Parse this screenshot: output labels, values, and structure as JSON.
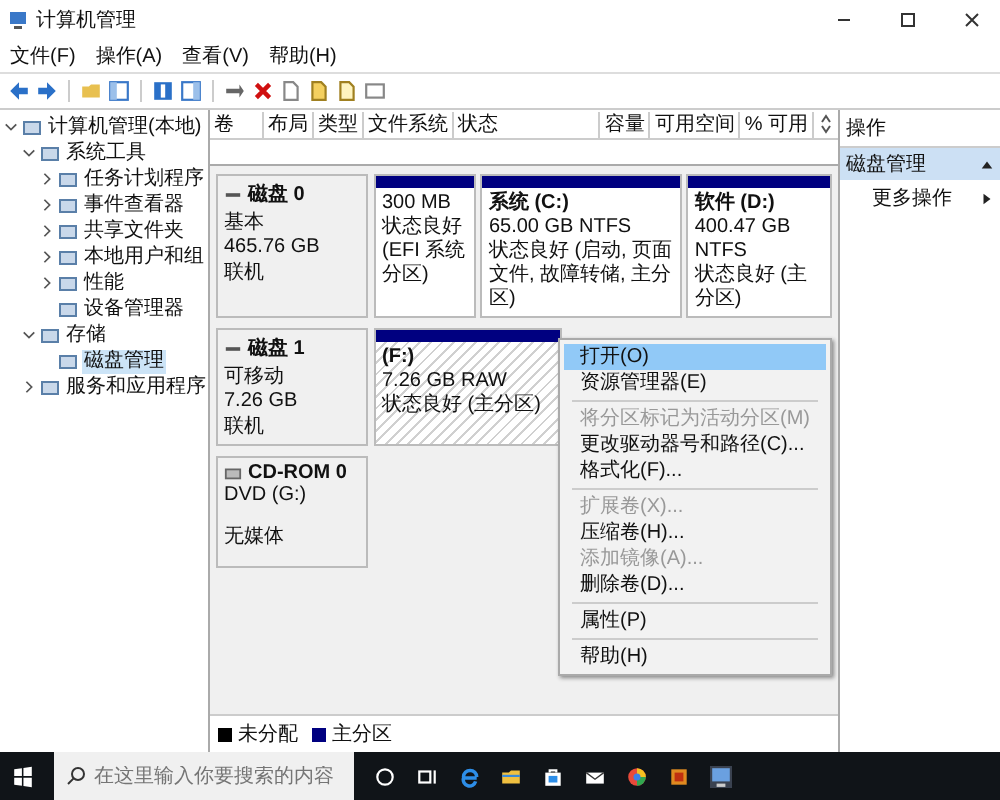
{
  "window": {
    "title": "计算机管理"
  },
  "menu_bar": [
    "文件(F)",
    "操作(A)",
    "查看(V)",
    "帮助(H)"
  ],
  "tree": [
    {
      "label": "计算机管理(本地)",
      "expanded": true,
      "selected": false,
      "children": [
        {
          "label": "系统工具",
          "expanded": true,
          "selected": false,
          "children": [
            {
              "label": "任务计划程序",
              "expanded": false,
              "selected": false
            },
            {
              "label": "事件查看器",
              "expanded": false,
              "selected": false
            },
            {
              "label": "共享文件夹",
              "expanded": false,
              "selected": false
            },
            {
              "label": "本地用户和组",
              "expanded": false,
              "selected": false
            },
            {
              "label": "性能",
              "expanded": false,
              "selected": false
            },
            {
              "label": "设备管理器",
              "selected": false
            }
          ]
        },
        {
          "label": "存储",
          "expanded": true,
          "selected": false,
          "children": [
            {
              "label": "磁盘管理",
              "selected": true
            }
          ]
        },
        {
          "label": "服务和应用程序",
          "expanded": false,
          "selected": false
        }
      ]
    }
  ],
  "table": {
    "columns": [
      "卷",
      "布局",
      "类型",
      "文件系统",
      "状态",
      "容量",
      "可用空间",
      "% 可用"
    ]
  },
  "disks": [
    {
      "kind": "disk",
      "name": "磁盘 0",
      "lines": [
        "基本",
        "465.76 GB",
        "联机"
      ],
      "partitions": [
        {
          "size": "300 MB",
          "status": "状态良好 (EFI 系统分区)",
          "selected": false
        },
        {
          "title": "系统 (C:)",
          "size": "65.00 GB NTFS",
          "status": "状态良好 (启动, 页面文件, 故障转储, 主分区)",
          "selected": false
        },
        {
          "title": "软件 (D:)",
          "size": "400.47 GB NTFS",
          "status": "状态良好 (主分区)",
          "selected": false
        }
      ]
    },
    {
      "kind": "disk",
      "name": "磁盘 1",
      "lines": [
        "可移动",
        "7.26 GB",
        "联机"
      ],
      "partitions": [
        {
          "title": "(F:)",
          "size": "7.26 GB RAW",
          "status": "状态良好 (主分区)",
          "selected": true
        }
      ]
    },
    {
      "kind": "cdrom",
      "name": "CD-ROM 0",
      "lines": [
        "DVD (G:)",
        "无媒体"
      ]
    }
  ],
  "legend": [
    {
      "label": "未分配",
      "color": "#000000"
    },
    {
      "label": "主分区",
      "color": "#000080"
    }
  ],
  "context_menu": [
    {
      "kind": "item",
      "label": "打开(O)",
      "selected": true,
      "disabled": false
    },
    {
      "kind": "item",
      "label": "资源管理器(E)",
      "selected": false,
      "disabled": false
    },
    {
      "kind": "separator"
    },
    {
      "kind": "item",
      "label": "将分区标记为活动分区(M)",
      "selected": false,
      "disabled": true
    },
    {
      "kind": "item",
      "label": "更改驱动器号和路径(C)...",
      "selected": false,
      "disabled": false
    },
    {
      "kind": "item",
      "label": "格式化(F)...",
      "selected": false,
      "disabled": false
    },
    {
      "kind": "separator"
    },
    {
      "kind": "item",
      "label": "扩展卷(X)...",
      "selected": false,
      "disabled": true
    },
    {
      "kind": "item",
      "label": "压缩卷(H)...",
      "selected": false,
      "disabled": false
    },
    {
      "kind": "item",
      "label": "添加镜像(A)...",
      "selected": false,
      "disabled": true
    },
    {
      "kind": "item",
      "label": "删除卷(D)...",
      "selected": false,
      "disabled": false
    },
    {
      "kind": "separator"
    },
    {
      "kind": "item",
      "label": "属性(P)",
      "selected": false,
      "disabled": false
    },
    {
      "kind": "separator"
    },
    {
      "kind": "item",
      "label": "帮助(H)",
      "selected": false,
      "disabled": false
    }
  ],
  "actions": {
    "title": "操作",
    "section": {
      "label": "磁盘管理",
      "selected": true
    },
    "items": [
      "更多操作"
    ]
  },
  "taskbar": {
    "search": {
      "placeholder": "在这里输入你要搜索的内容"
    }
  }
}
